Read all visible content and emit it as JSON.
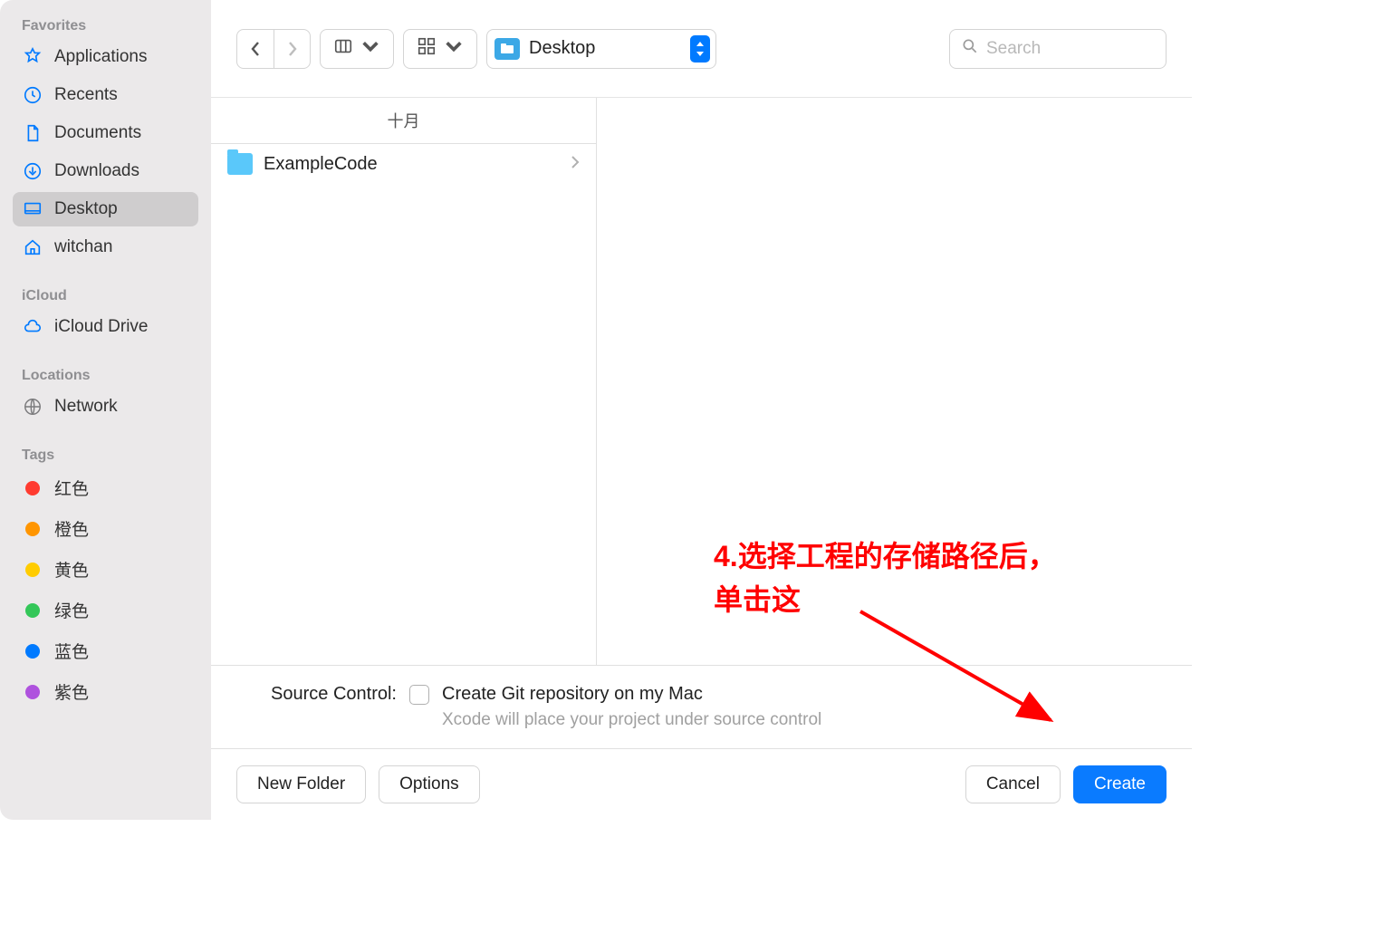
{
  "sidebar": {
    "favorites_label": "Favorites",
    "items": [
      {
        "label": "Applications",
        "icon": "applications"
      },
      {
        "label": "Recents",
        "icon": "recents"
      },
      {
        "label": "Documents",
        "icon": "documents"
      },
      {
        "label": "Downloads",
        "icon": "downloads"
      },
      {
        "label": "Desktop",
        "icon": "desktop",
        "selected": true
      },
      {
        "label": "witchan",
        "icon": "home"
      }
    ],
    "icloud_label": "iCloud",
    "icloud_items": [
      {
        "label": "iCloud Drive",
        "icon": "cloud"
      }
    ],
    "locations_label": "Locations",
    "location_items": [
      {
        "label": "Network",
        "icon": "network"
      }
    ],
    "tags_label": "Tags",
    "tags": [
      {
        "label": "红色",
        "color": "#ff3b30"
      },
      {
        "label": "橙色",
        "color": "#ff9500"
      },
      {
        "label": "黄色",
        "color": "#ffcc00"
      },
      {
        "label": "绿色",
        "color": "#34c759"
      },
      {
        "label": "蓝色",
        "color": "#007aff"
      },
      {
        "label": "紫色",
        "color": "#af52de"
      }
    ]
  },
  "toolbar": {
    "path_label": "Desktop",
    "search_placeholder": "Search"
  },
  "browser": {
    "column_header": "十月",
    "items": [
      {
        "name": "ExampleCode",
        "type": "folder"
      }
    ]
  },
  "source_control": {
    "label": "Source Control:",
    "checkbox_label": "Create Git repository on my Mac",
    "hint": "Xcode will place your project under source control"
  },
  "footer": {
    "new_folder": "New Folder",
    "options": "Options",
    "cancel": "Cancel",
    "create": "Create"
  },
  "annotation": {
    "line1": "4.选择工程的存储路径后，",
    "line2": "单击这"
  }
}
